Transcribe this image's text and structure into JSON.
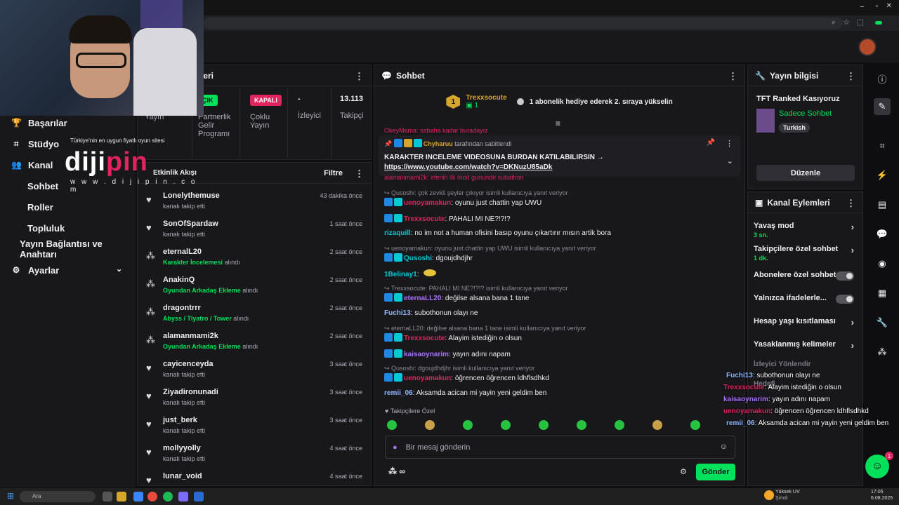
{
  "browser": {
    "title": ""
  },
  "logo": {
    "tagline": "Türkiye'nin en uygun fiyatlı oyun sitesi",
    "brand_a": "diji",
    "brand_b": "pin",
    "website": "w w w . d i j i p i n . c o m"
  },
  "sidebar": {
    "items": [
      {
        "label": "Başarılar",
        "icon": "trophy-icon"
      },
      {
        "label": "Stüdyo",
        "icon": "studio-icon"
      },
      {
        "label": "Kanal",
        "icon": "users-icon"
      },
      {
        "label": "Sohbet"
      },
      {
        "label": "Roller"
      },
      {
        "label": "Topluluk"
      },
      {
        "label": "Yayın Bağlantısı ve Anahtarı"
      },
      {
        "label": "Ayarlar",
        "icon": "gear-icon"
      }
    ]
  },
  "stats": {
    "title": "leri",
    "cols": [
      {
        "label": "Yayın",
        "value": ""
      },
      {
        "pill": "ÇIK",
        "pill_color": "#00e05a",
        "label": "Partnerlik Gelir Programı"
      },
      {
        "pill": "KAPALI",
        "pill_color": "#e0245e",
        "label": "Çoklu Yayın"
      },
      {
        "value": "-",
        "label": "İzleyici"
      },
      {
        "value": "13.113",
        "label": "Takipçi"
      }
    ]
  },
  "activity": {
    "title": "Etkinlik Akışı",
    "filter": "Filtre",
    "items": [
      {
        "name": "Lonelythemuse",
        "desc": "kanalı takip etti",
        "time": "43 dakika önce",
        "type": "follow"
      },
      {
        "name": "SonOfSpardaw",
        "desc": "kanalı takip etti",
        "time": "1 saat önce",
        "type": "follow"
      },
      {
        "name": "eternalL20",
        "hl": "Karakter İncelemesi",
        "desc": "alındı",
        "time": "2 saat önce",
        "type": "redeem"
      },
      {
        "name": "AnakinQ",
        "hl": "Oyundan Arkadaş Ekleme",
        "desc": "alındı",
        "time": "2 saat önce",
        "type": "redeem"
      },
      {
        "name": "dragontrrr",
        "hl": "Abyss / Tiyatro / Tower",
        "desc": "alındı",
        "time": "2 saat önce",
        "type": "redeem"
      },
      {
        "name": "alamanmami2k",
        "hl": "Oyundan Arkadaş Ekleme",
        "desc": "alındı",
        "time": "2 saat önce",
        "type": "redeem"
      },
      {
        "name": "cayicenceyda",
        "desc": "kanalı takip etti",
        "time": "3 saat önce",
        "type": "follow"
      },
      {
        "name": "Ziyadironunadi",
        "desc": "kanalı takip etti",
        "time": "3 saat önce",
        "type": "follow"
      },
      {
        "name": "just_berk",
        "desc": "kanalı takip etti",
        "time": "3 saat önce",
        "type": "follow"
      },
      {
        "name": "mollyyolly",
        "desc": "kanalı takip etti",
        "time": "4 saat önce",
        "type": "follow"
      },
      {
        "name": "lunar_void",
        "desc": "",
        "time": "4 saat önce",
        "type": "follow"
      }
    ]
  },
  "chat": {
    "title": "Sohbet",
    "banner": {
      "user": "Trexxsocute",
      "count": "1",
      "text": "1 abonelik hediye ederek 2. sıraya yükselin"
    },
    "pinned": {
      "by_user": "Chyharuu",
      "by_text": "tarafından sabitlendi",
      "text": "KARAKTER INCELEME VIDEOSUNA BURDAN KATILABILIRSIN →",
      "link": "https://www.youtube.com/watch?v=DKNuzU85aDk"
    },
    "partial_top": "OkeyMama: sabaha kadar buradayız",
    "partial_2": "alamanmami2k: efenin ilk mod gununde subathon",
    "messages": [
      {
        "reply": "Qusoshi: çok zevkli şeyler çıkıyor isimli kullanıcıya yanıt veriyor"
      },
      {
        "user": "uenoyamakun",
        "color": "#e0245e",
        "text": "oyunu just chattin yap UWU"
      },
      {
        "user": "Trexxsocute",
        "color": "#e0245e",
        "text": "PAHALI MI NE?!?!?"
      },
      {
        "user": "rizaquill",
        "color": "#00c8d7",
        "text": "no im not a human ofisini basıp oyunu çıkartırır mısın artik bora"
      },
      {
        "reply": "uenoyamakun: oyunu just chattin yap UWU isimli kullanıcıya yanıt veriyor"
      },
      {
        "user": "Qusoshi",
        "color": "#00c8d7",
        "text": "dgoujdhdjhr"
      },
      {
        "user": "1Belinay1",
        "color": "#00c8d7",
        "text": ""
      },
      {
        "reply": "Trexxsocute: PAHALI MI NE?!?!? isimli kullanıcıya yanıt veriyor"
      },
      {
        "user": "eternaLL20",
        "color": "#a970ff",
        "text": "değilse alsana bana 1 tane"
      },
      {
        "user": "Fuchi13",
        "color": "#8fb6ff",
        "text": "subothonun olayı ne"
      },
      {
        "reply": "eternaLL20: değilse alsana bana 1 tane isimli kullanıcıya yanıt veriyor"
      },
      {
        "user": "Trexxsocute",
        "color": "#e0245e",
        "text": "Alayim istediğin o olsun"
      },
      {
        "user": "kaisaoynarim",
        "color": "#a970ff",
        "text": "yayın adını napam"
      },
      {
        "reply": "Qusoshi: dgoujdhdjhr isimli kullanıcıya yanıt veriyor"
      },
      {
        "user": "uenoyamakun",
        "color": "#e0245e",
        "text": "öğrencen öğrencen ldhflsdhkd"
      },
      {
        "user": "remii_06",
        "color": "#8fb6ff",
        "text": "Aksamda acican mi yayin yeni geldim ben"
      }
    ],
    "emote_label": "Takipçilere Özel",
    "input_placeholder": "Bir mesaj gönderin",
    "points": "∞",
    "send": "Gönder"
  },
  "info": {
    "title": "Yayın bilgisi",
    "stream_title": "TFT Ranked Kasıyoruz",
    "category": "Sadece Sohbet",
    "tag": "Turkish",
    "edit": "Düzenle"
  },
  "actions": {
    "title": "Kanal Eylemleri",
    "items": [
      {
        "label": "Yavaş mod",
        "sub": "3 sn.",
        "ctl": "chevron"
      },
      {
        "label": "Takipçilere özel sohbet",
        "sub": "1 dk.",
        "ctl": "chevron"
      },
      {
        "label": "Abonelere özel sohbet",
        "ctl": "toggle"
      },
      {
        "label": "Yalnızca ifadelerle...",
        "ctl": "toggle"
      },
      {
        "label": "Hesap yaşı kısıtlaması",
        "ctl": "chevron"
      },
      {
        "label": "Yasaklanmış kelimeler",
        "ctl": "chevron"
      },
      {
        "label": "İzleyici Yönlendir",
        "ctl": "none"
      },
      {
        "label": "Hedefl",
        "ctl": "none"
      }
    ]
  },
  "overlay": [
    {
      "user": "Fuchi13",
      "color": "#8fb6ff",
      "text": ": subothonun olayı ne"
    },
    {
      "user": "Trexxsocute",
      "color": "#e0245e",
      "text": ": Alayim istediğin o olsun"
    },
    {
      "user": "kaisaoynarim",
      "color": "#a970ff",
      "text": ": yayın adını napam"
    },
    {
      "user": "uenoyamakun",
      "color": "#e0245e",
      "text": ": öğrencen öğrencen ldhflsdhkd"
    },
    {
      "user": "remii_06",
      "color": "#8fb6ff",
      "text": ": Aksamda acican mi yayin yeni geldim ben"
    }
  ],
  "taskbar": {
    "search": "Ara",
    "weather_label": "Yüksek UV",
    "weather_sub": "Şimdi",
    "time": "17:05",
    "date": "6.08.2025"
  },
  "colors": {
    "accent": "#00e05a",
    "bg": "#0e0e10",
    "panel": "#18181b"
  }
}
